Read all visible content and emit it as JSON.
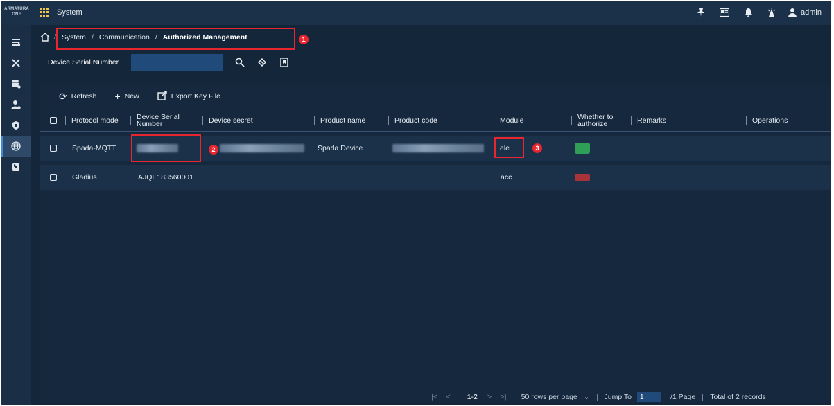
{
  "app": {
    "logo_line1": "ARMATURA",
    "logo_line2": "ONE",
    "title": "System",
    "user_name": "admin"
  },
  "header_icons": [
    "pin-icon",
    "id-card-icon",
    "bell-icon",
    "alarm-tower-icon",
    "user-icon"
  ],
  "sidebar": {
    "items": [
      {
        "icon": "list-icon",
        "glyph": "≡"
      },
      {
        "icon": "tools-icon",
        "glyph": "✕"
      },
      {
        "icon": "database-icon",
        "glyph": "☰"
      },
      {
        "icon": "user-settings-icon",
        "glyph": "♟"
      },
      {
        "icon": "shield-icon",
        "glyph": "⬢"
      },
      {
        "icon": "globe-icon",
        "glyph": "⊕",
        "active": true
      },
      {
        "icon": "door-icon",
        "glyph": "▮"
      }
    ]
  },
  "breadcrumb": {
    "items": [
      "System",
      "Communication",
      "Authorized Management"
    ],
    "separator": "/"
  },
  "filter": {
    "label": "Device Serial Number",
    "value": ""
  },
  "toolbar": {
    "refresh_label": "Refresh",
    "new_label": "New",
    "export_label": "Export Key File"
  },
  "table": {
    "columns": {
      "protocol_mode": "Protocol mode",
      "device_serial_1": "Device Serial",
      "device_serial_2": "Number",
      "device_secret": "Device secret",
      "product_name": "Product name",
      "product_code": "Product code",
      "module": "Module",
      "authorize_1": "Whether to",
      "authorize_2": "authorize",
      "remarks": "Remarks",
      "operations": "Operations"
    },
    "rows": [
      {
        "protocol_mode": "Spada-MQTT",
        "device_serial": "",
        "device_secret": "",
        "product_name": "Spada Device",
        "product_code": "",
        "module": "ele",
        "authorized": true
      },
      {
        "protocol_mode": "Gladius",
        "device_serial": "AJQE183560001",
        "device_secret": "",
        "product_name": "",
        "product_code": "",
        "module": "acc",
        "authorized": false
      }
    ]
  },
  "annotations": [
    "1",
    "2",
    "3"
  ],
  "pagination": {
    "range": "1-2",
    "rows_per_page": "50 rows per page",
    "jump_to_label": "Jump To",
    "page_value": "1",
    "pages_label": "/1 Page",
    "total_label": "Total of 2 records"
  },
  "colors": {
    "background": "#13263a",
    "header": "#1b3149",
    "accent": "#3b8bd8",
    "annotation_red": "#e8262f",
    "authorized_green": "#2f9e57",
    "unauthorized_red": "#a8343a"
  }
}
